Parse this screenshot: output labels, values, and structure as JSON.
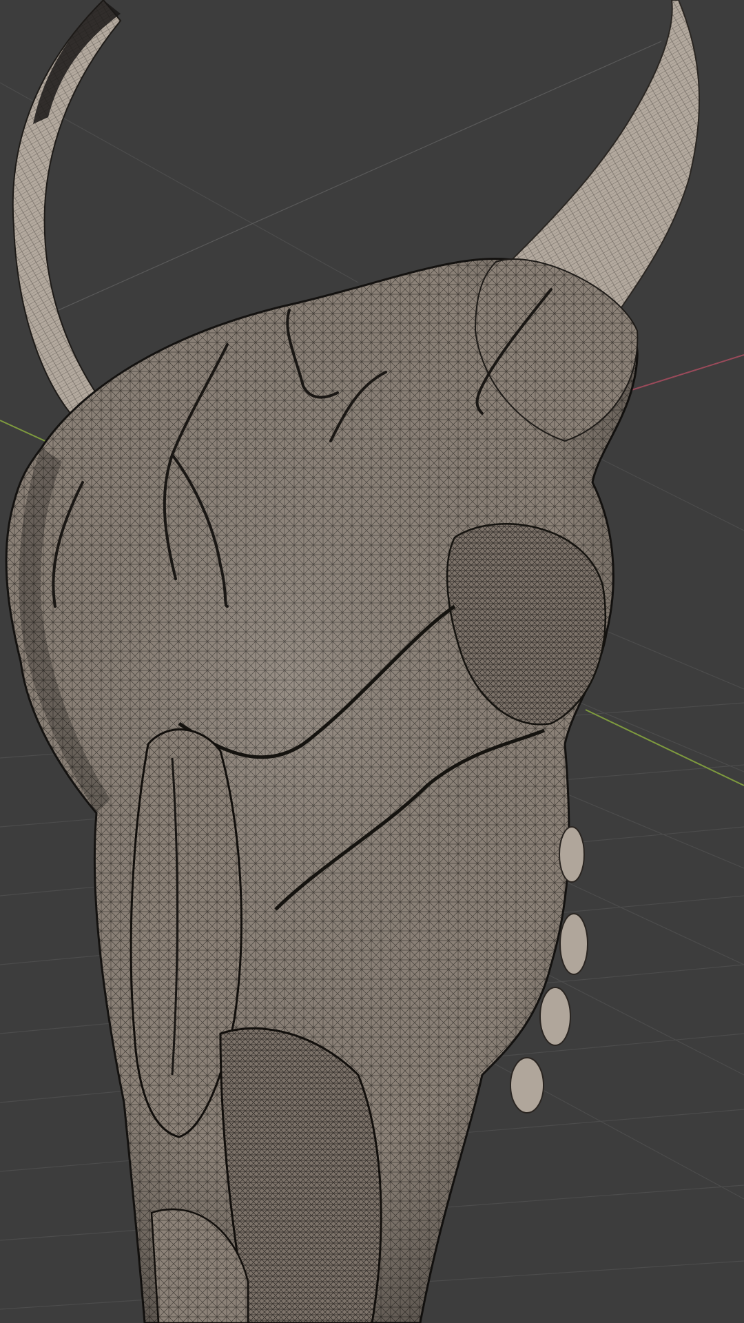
{
  "viewport": {
    "background_color": "#3d3d3d",
    "grid_color": "#4a4a4a",
    "axis_x_color": "#9a4a5a",
    "axis_y_color": "#7e9a3e",
    "mesh_surface_color": "#8a8076",
    "mesh_wire_color": "#2a2622",
    "horn_color": "#b3a99e"
  },
  "scene": {
    "object": "skull-mesh",
    "display_mode": "solid-wireframe",
    "components": [
      "left-horn",
      "right-horn",
      "cranium",
      "eye-socket",
      "nasal-bone",
      "snout",
      "teeth"
    ]
  }
}
